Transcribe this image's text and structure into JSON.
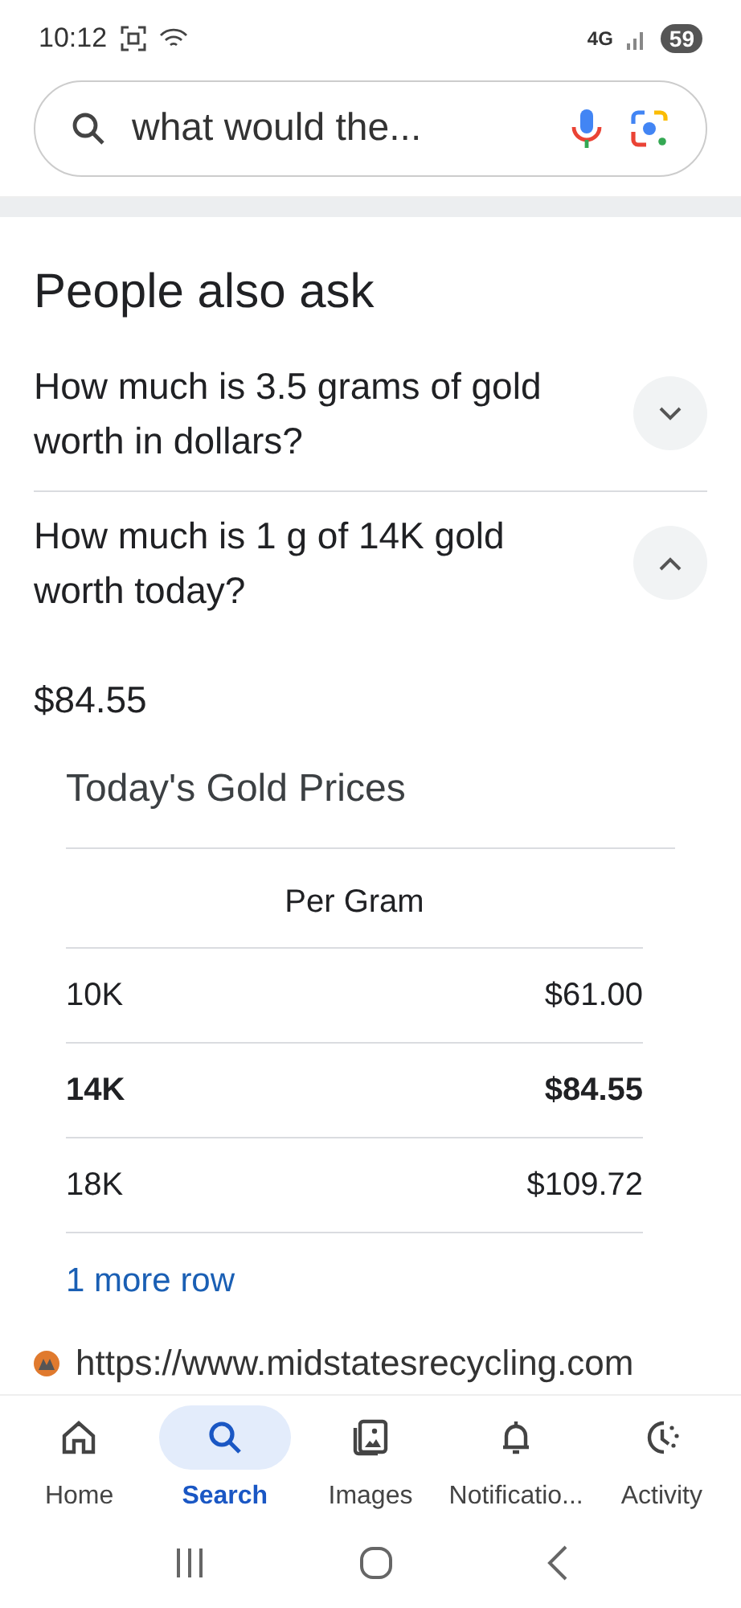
{
  "status_bar": {
    "time": "10:12",
    "network": "4G",
    "battery": "59"
  },
  "search": {
    "value": "what would the..."
  },
  "section_title": "People also ask",
  "questions": [
    {
      "text": "How much is 3.5 grams of gold worth in dollars?",
      "expanded": false
    },
    {
      "text": "How much is 1 g of 14K gold worth today?",
      "expanded": true
    }
  ],
  "answer": {
    "value": "$84.55",
    "table_title": "Today's Gold Prices",
    "column": "Per Gram",
    "rows": [
      {
        "karat": "10K",
        "price": "$61.00",
        "highlighted": false
      },
      {
        "karat": "14K",
        "price": "$84.55",
        "highlighted": true
      },
      {
        "karat": "18K",
        "price": "$109.72",
        "highlighted": false
      }
    ],
    "more_link": "1 more row",
    "source_url": "https://www.midstatesrecycling.com"
  },
  "bottom_nav": [
    {
      "label": "Home",
      "kind": "home",
      "selected": false
    },
    {
      "label": "Search",
      "kind": "search",
      "selected": true
    },
    {
      "label": "Images",
      "kind": "images",
      "selected": false
    },
    {
      "label": "Notificatio...",
      "kind": "bell",
      "selected": false
    },
    {
      "label": "Activity",
      "kind": "activity",
      "selected": false
    }
  ]
}
